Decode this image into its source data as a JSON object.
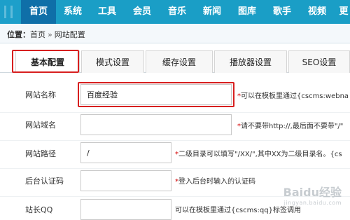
{
  "nav": {
    "items": [
      "首页",
      "系统",
      "工具",
      "会员",
      "音乐",
      "新闻",
      "图库",
      "歌手",
      "视频",
      "更"
    ],
    "active_index": 0
  },
  "breadcrumb": {
    "label": "位置：",
    "home": "首页",
    "current": "网站配置"
  },
  "tabs": [
    "基本配置",
    "模式设置",
    "缓存设置",
    "播放器设置",
    "SEO设置"
  ],
  "form": {
    "rows": [
      {
        "label": "网站名称",
        "value": "百度经验",
        "hint": "*可以在模板里通过{cscms:webna"
      },
      {
        "label": "网站域名",
        "value": "",
        "hint": "*请不要带http://,最后面不要带\"/\""
      },
      {
        "label": "网站路径",
        "value": "/",
        "hint": "*二级目录可以填写\"/XX/\",其中XX为二级目录名。{cs"
      },
      {
        "label": "后台认证码",
        "value": "",
        "hint": "*登入后台时输入的认证码"
      },
      {
        "label": "站长QQ",
        "value": "",
        "hint": "可以在模板里通过{cscms:qq}标签调用"
      }
    ]
  },
  "watermark": {
    "text": "Baidu经验",
    "sub": "jingyan.baidu.com"
  },
  "colors": {
    "nav_bg": "#1a9ec6",
    "nav_active": "#0f6fa8",
    "highlight": "#d71f1f",
    "required_star": "#d40000"
  }
}
